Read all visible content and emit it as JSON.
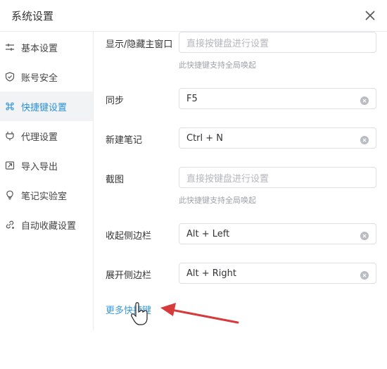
{
  "dialog": {
    "title": "系统设置"
  },
  "sidebar": {
    "items": [
      {
        "label": "基本设置",
        "icon": "sliders-icon"
      },
      {
        "label": "账号安全",
        "icon": "shield-icon"
      },
      {
        "label": "快捷键设置",
        "icon": "command-key-icon",
        "active": true
      },
      {
        "label": "代理设置",
        "icon": "plug-icon"
      },
      {
        "label": "导入导出",
        "icon": "import-export-icon"
      },
      {
        "label": "笔记实验室",
        "icon": "lightbulb-icon"
      },
      {
        "label": "自动收藏设置",
        "icon": "link-collect-icon"
      }
    ]
  },
  "shortcuts": [
    {
      "label": "显示/隐藏主窗口",
      "value": "",
      "placeholder": "直接按键盘进行设置",
      "hint": "此快捷键支持全局唤起"
    },
    {
      "label": "同步",
      "value": "F5",
      "placeholder": ""
    },
    {
      "label": "新建笔记",
      "value": "Ctrl + N",
      "placeholder": ""
    },
    {
      "label": "截图",
      "value": "",
      "placeholder": "直接按键盘进行设置",
      "hint": "此快捷键支持全局唤起"
    },
    {
      "label": "收起侧边栏",
      "value": "Alt + Left",
      "placeholder": ""
    },
    {
      "label": "展开侧边栏",
      "value": "Alt + Right",
      "placeholder": ""
    }
  ],
  "more_link": "更多快捷键",
  "colors": {
    "accent": "#2a91d8",
    "link": "#3a9ad9",
    "arrow": "#d63a3a"
  }
}
